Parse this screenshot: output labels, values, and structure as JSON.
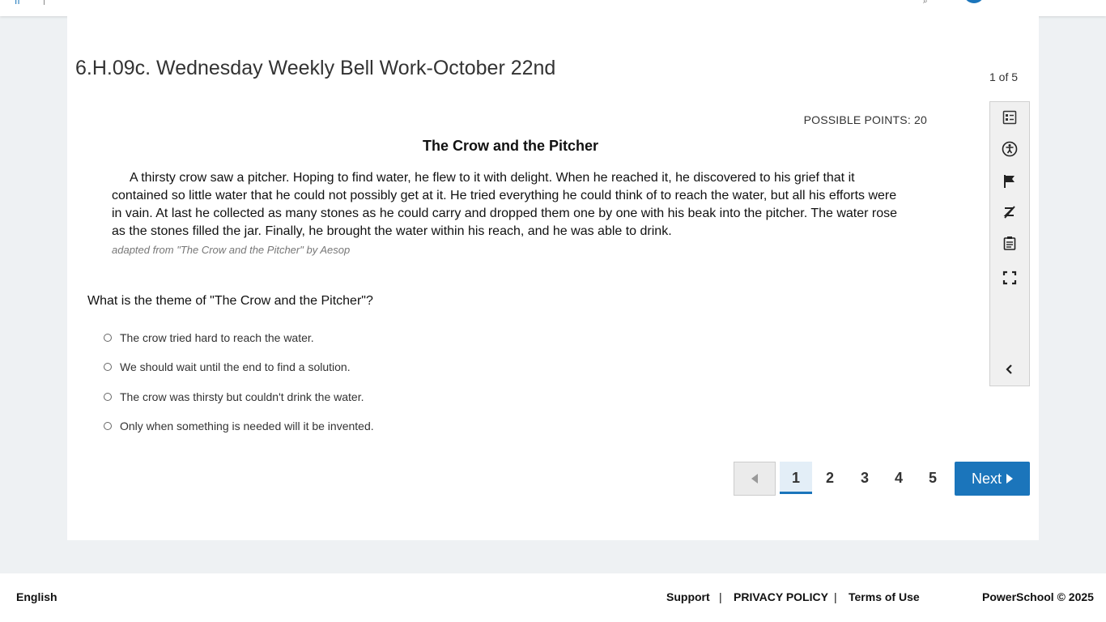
{
  "header": {
    "logo_text": "ıı",
    "mini_icon": "search-icon"
  },
  "assessment": {
    "title": "6.H.09c. Wednesday Weekly Bell Work-October 22nd",
    "counter": "1 of 5",
    "possible_points": "POSSIBLE POINTS: 20"
  },
  "passage": {
    "title": "The Crow and the Pitcher",
    "text": "A thirsty crow saw a pitcher. Hoping to find water, he flew to it with delight. When he reached it, he discovered to his grief that it contained so little water that he could not possibly get at it. He tried everything he could think of to reach the water, but all his efforts were in vain. At last he collected as many stones as he could carry and dropped them one by one with his beak into the pitcher. The water rose as the stones filled the jar. Finally, he brought the water within his reach, and he was able to drink.",
    "source": "adapted from \"The Crow and the Pitcher\" by Aesop"
  },
  "question": {
    "prompt": "What is the theme of \"The Crow and the Pitcher\"?",
    "options": [
      "The crow tried hard to reach the water.",
      "We should wait until the end to find a solution.",
      "The crow was thirsty but couldn't drink the water.",
      "Only when something is needed will it be invented."
    ]
  },
  "tools": [
    "reference-list-icon",
    "accessibility-icon",
    "flag-icon",
    "eliminate-icon",
    "notepad-icon",
    "fullscreen-icon",
    "collapse-icon"
  ],
  "pagination": {
    "pages": [
      "1",
      "2",
      "3",
      "4",
      "5"
    ],
    "active_page": "1",
    "next_label": "Next"
  },
  "footer": {
    "language": "English",
    "support": "Support",
    "privacy": "PRIVACY POLICY",
    "terms": "Terms of Use",
    "separator": "|",
    "copyright": "PowerSchool © 2025"
  },
  "colors": {
    "accent": "#1b75bb",
    "background": "#eef1f3"
  }
}
